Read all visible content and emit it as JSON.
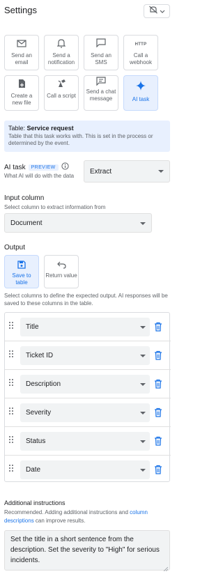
{
  "header": {
    "title": "Settings",
    "toggle_icon": "notifications-off-icon"
  },
  "task_types": [
    {
      "label": "Send an email",
      "icon": "mail-icon"
    },
    {
      "label": "Send a notification",
      "icon": "bell-icon"
    },
    {
      "label": "Send an SMS",
      "icon": "sms-icon"
    },
    {
      "label": "Call a webhook",
      "icon": "http-icon",
      "icon_text": "HTTP"
    },
    {
      "label": "Create a new file",
      "icon": "file-icon"
    },
    {
      "label": "Call a script",
      "icon": "script-icon"
    },
    {
      "label": "Send a chat message",
      "icon": "chat-icon"
    },
    {
      "label": "AI task",
      "icon": "sparkle-icon",
      "selected": true
    }
  ],
  "info": {
    "table_prefix": "Table:",
    "table_name": "Service request",
    "description": "Table that this task works with. This is set in the process or determined by the event."
  },
  "ai_task": {
    "label": "AI task",
    "badge": "PREVIEW",
    "description": "What AI will do with the data",
    "value": "Extract"
  },
  "input_column": {
    "label": "Input column",
    "description": "Select column to extract information from",
    "value": "Document"
  },
  "output": {
    "label": "Output",
    "options": [
      {
        "label": "Save to table",
        "icon": "save-icon",
        "selected": true
      },
      {
        "label": "Return value",
        "icon": "undo-icon",
        "selected": false
      }
    ],
    "description": "Select columns to define the expected output. AI responses will be saved to these columns in the table.",
    "columns": [
      "Title",
      "Ticket ID",
      "Description",
      "Severity",
      "Status",
      "Date"
    ]
  },
  "additional_instructions": {
    "label": "Additional instructions",
    "description_start": "Recommended. Adding additional instructions and ",
    "link_text": "column descriptions",
    "description_end": " can improve results.",
    "value": "Set the title in a short sentence from the description. Set the severity to \"High\" for serious incidents."
  },
  "colors": {
    "accent": "#1a73e8",
    "selected_bg": "#e8f0fe",
    "field_bg": "#f1f3f4",
    "muted_text": "#5f6368"
  }
}
